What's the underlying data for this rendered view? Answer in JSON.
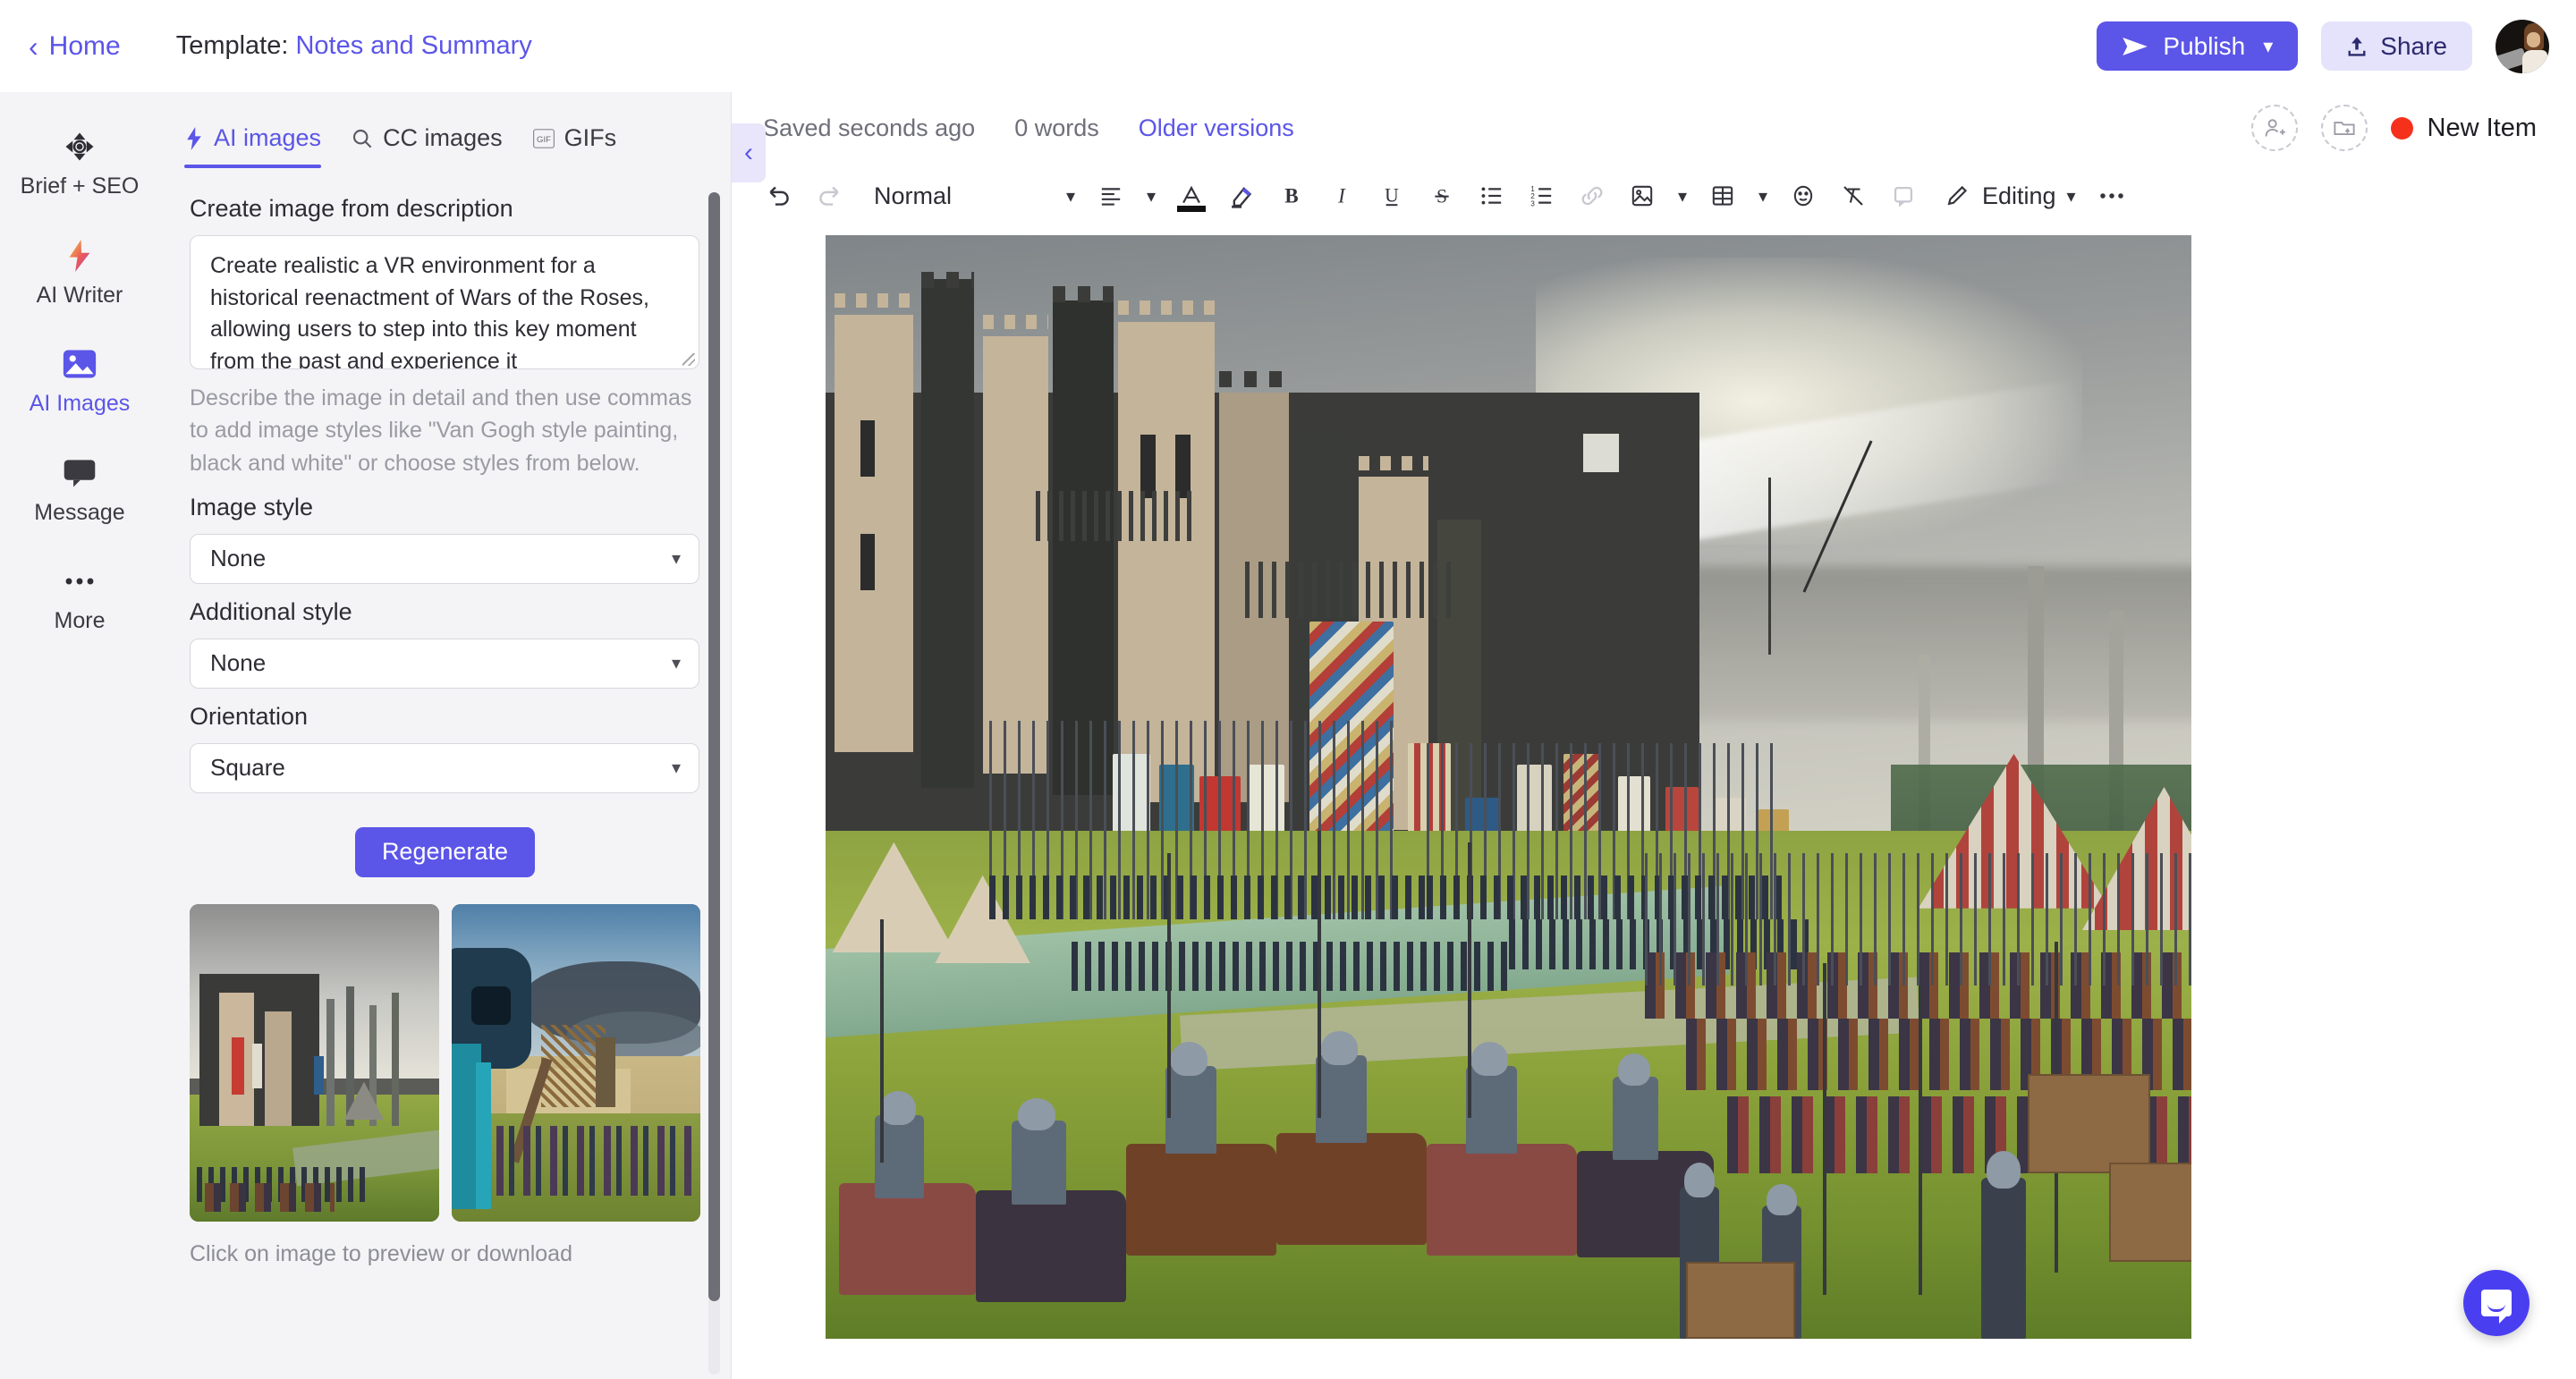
{
  "topbar": {
    "home_label": "Home",
    "template_prefix": "Template:",
    "template_name": "Notes and Summary",
    "publish_label": "Publish",
    "share_label": "Share"
  },
  "rail": {
    "items": [
      {
        "label": "Brief + SEO",
        "icon": "target-icon",
        "active": false
      },
      {
        "label": "AI Writer",
        "icon": "lightning-icon",
        "active": false
      },
      {
        "label": "AI Images",
        "icon": "image-icon",
        "active": true
      },
      {
        "label": "Message",
        "icon": "chat-icon",
        "active": false
      },
      {
        "label": "More",
        "icon": "ellipsis-icon",
        "active": false
      }
    ]
  },
  "panel": {
    "tabs": [
      {
        "label": "AI images",
        "icon": "lightning-icon",
        "active": true
      },
      {
        "label": "CC images",
        "icon": "search-icon",
        "active": false
      },
      {
        "label": "GIFs",
        "icon": "gif-icon",
        "active": false
      }
    ],
    "prompt_heading": "Create image from description",
    "prompt_value": "Create realistic a VR environment for a historical reenactment of Wars of the Roses, allowing users to step into this key moment from the past and experience it",
    "prompt_placeholder": "Describe the image in detail",
    "hint": "Describe the image in detail and then use commas to add image styles like \"Van Gogh style painting, black and white\" or choose styles from below.",
    "image_style_label": "Image style",
    "image_style_value": "None",
    "additional_style_label": "Additional style",
    "additional_style_value": "None",
    "orientation_label": "Orientation",
    "orientation_value": "Square",
    "regenerate_label": "Regenerate",
    "thumb_caption": "Click on image to preview or download"
  },
  "editor": {
    "saved_text": "Saved seconds ago",
    "word_count": "0 words",
    "older_versions": "Older versions",
    "status_label": "New Item",
    "status_color": "#f5311c",
    "toolbar": {
      "undo": "undo-icon",
      "redo": "redo-icon",
      "block_style": "Normal",
      "align": "align-icon",
      "font_color": "font-color-icon",
      "highlight": "highlight-icon",
      "bold": "B",
      "italic": "I",
      "underline": "U",
      "strike": "S",
      "bullet_list": "bullet-list-icon",
      "numbered_list": "numbered-list-icon",
      "link": "link-icon",
      "image": "image-icon",
      "table": "table-icon",
      "emoji": "emoji-icon",
      "clear_format": "clear-format-icon",
      "comment": "comment-icon",
      "mode_label": "Editing",
      "more": "ellipsis-icon"
    }
  },
  "colors": {
    "accent": "#5b55e8",
    "accent_soft": "#e5e3fb",
    "panel_bg": "#f4f4f6",
    "status_red": "#f5311c",
    "chat_fab": "#4a3ff0"
  }
}
